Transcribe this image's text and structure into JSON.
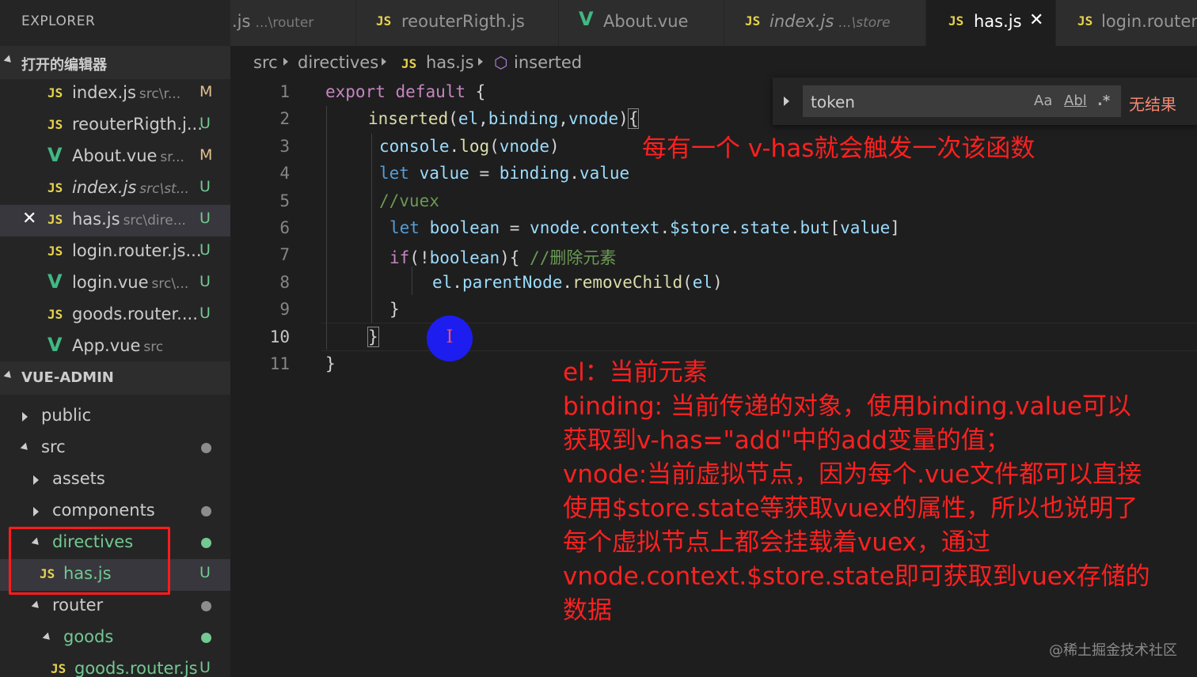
{
  "colors": {
    "editor_bg": "#1e1e1e",
    "sidebar_bg": "#252526",
    "accent_red": "#ff2020",
    "js_icon": "#e8d44d",
    "vue_icon": "#41b883",
    "modified": "#e2c08d",
    "untracked": "#73c991"
  },
  "sidebar": {
    "title": "EXPLORER",
    "open_editors_title": "打开的编辑器",
    "open_editors": [
      {
        "icon": "js-icon",
        "name": "index.js",
        "path": "src\\r...",
        "status": "M"
      },
      {
        "icon": "js-icon",
        "name": "reouterRigth.j...",
        "path": "",
        "status": "U"
      },
      {
        "icon": "vue-icon",
        "name": "About.vue",
        "path": "sr...",
        "status": "M"
      },
      {
        "icon": "js-icon",
        "name": "index.js",
        "path": "src\\st...",
        "status": "U"
      },
      {
        "icon": "js-icon",
        "name": "has.js",
        "path": "src\\dire...",
        "status": "U",
        "close": "✕"
      },
      {
        "icon": "js-icon",
        "name": "login.router.js...",
        "path": "",
        "status": "U"
      },
      {
        "icon": "vue-icon",
        "name": "login.vue",
        "path": "src\\...",
        "status": "U"
      },
      {
        "icon": "js-icon",
        "name": "goods.router....",
        "path": "",
        "status": "U"
      },
      {
        "icon": "vue-icon",
        "name": "App.vue",
        "path": "src",
        "status": ""
      }
    ],
    "project_title": "VUE-ADMIN",
    "tree": [
      {
        "name": "public"
      },
      {
        "name": "src"
      },
      {
        "name": "assets"
      },
      {
        "name": "components"
      },
      {
        "name": "directives"
      },
      {
        "name": "has.js",
        "status": "U"
      },
      {
        "name": "router"
      },
      {
        "name": "goods"
      },
      {
        "name": "goods.router.js",
        "status": "U"
      }
    ]
  },
  "tabs": [
    {
      "icon": "js-icon",
      "label": ".js",
      "path": "...\\router"
    },
    {
      "icon": "js-icon",
      "label": "reouterRigth.js",
      "path": ""
    },
    {
      "icon": "vue-icon",
      "label": "About.vue",
      "path": ""
    },
    {
      "icon": "js-icon",
      "label": "index.js",
      "path": "...\\store"
    },
    {
      "icon": "js-icon",
      "label": "has.js",
      "path": "",
      "close": "✕"
    },
    {
      "icon": "js-icon",
      "label": "login.router.",
      "path": ""
    }
  ],
  "breadcrumb": {
    "src": "src",
    "directives": "directives",
    "file": "has.js",
    "symbol": "inserted"
  },
  "editor": {
    "line_numbers": [
      "1",
      "2",
      "3",
      "4",
      "5",
      "6",
      "7",
      "8",
      "9",
      "10",
      "11"
    ],
    "current_line": "10"
  },
  "find": {
    "value": "token",
    "match_case": "Aa",
    "whole_word": "Abl",
    "regex": ".*",
    "result": "无结果"
  },
  "annotations": {
    "top": "每有一个 v-has就会触发一次该函数",
    "lines": [
      "el：当前元素",
      "binding: 当前传递的对象，使用binding.value可以",
      "获取到v-has=\"add\"中的add变量的值；",
      "vnode:当前虚拟节点，因为每个.vue文件都可以直接",
      "使用$store.state等获取vuex的属性，所以也说明了",
      "每个虚拟节点上都会挂载着vuex，通过",
      "vnode.context.$store.state即可获取到vuex存储的",
      "数据"
    ]
  },
  "watermark": "@稀土掘金技术社区"
}
